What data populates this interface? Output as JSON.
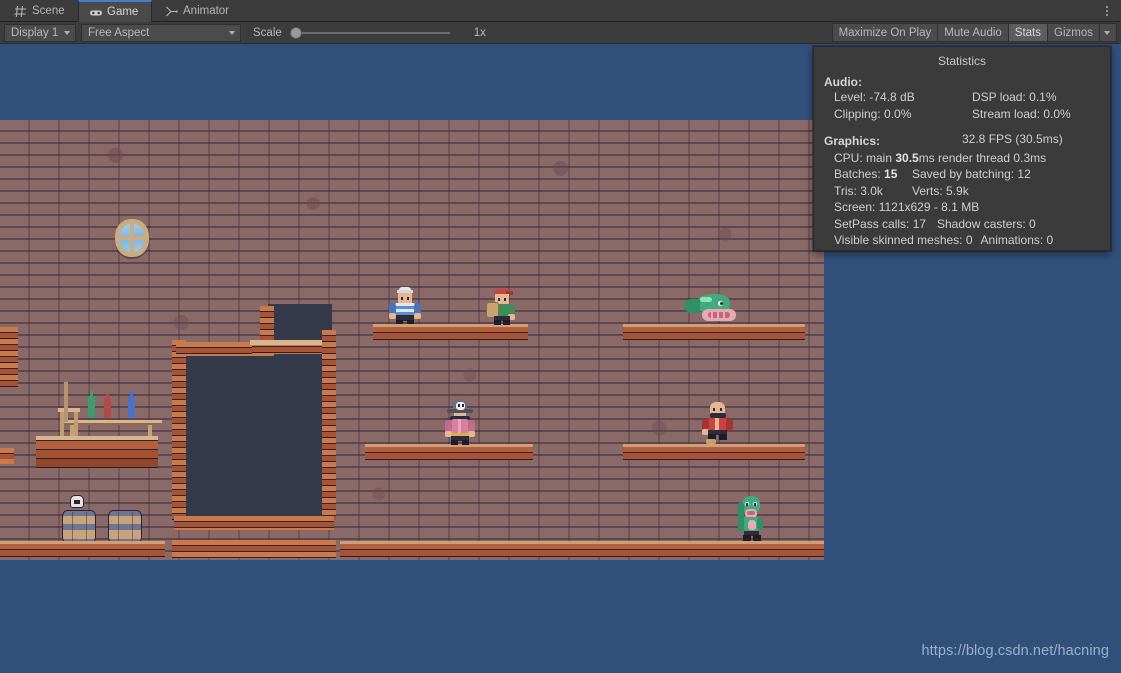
{
  "window": {
    "tabs": [
      {
        "label": "Scene",
        "icon": "grid-icon",
        "active": false
      },
      {
        "label": "Game",
        "icon": "gamepad-icon",
        "active": true
      },
      {
        "label": "Animator",
        "icon": "animator-icon",
        "active": false
      }
    ],
    "overflow_menu_icon": "kebab-menu-icon"
  },
  "toolbar": {
    "display_label": "Display 1",
    "aspect_label": "Free Aspect",
    "scale_label": "Scale",
    "scale_value": "1x",
    "maximize_on_play_label": "Maximize On Play",
    "mute_audio_label": "Mute Audio",
    "stats_label": "Stats",
    "stats_active": true,
    "gizmos_label": "Gizmos",
    "gizmos_caret_icon": "chevron-down-icon"
  },
  "statistics": {
    "title": "Statistics",
    "audio_heading": "Audio:",
    "audio_level": "Level: -74.8 dB",
    "audio_clipping": "Clipping: 0.0%",
    "dsp_load": "DSP load: 0.1%",
    "stream_load": "Stream load: 0.0%",
    "graphics_heading": "Graphics:",
    "fps": "32.8 FPS (30.5ms)",
    "cpu_prefix": "CPU: main ",
    "cpu_main_value": "30.5",
    "cpu_suffix": "ms  render thread 0.3ms",
    "batches_prefix": "Batches: ",
    "batches_value": "15",
    "saved_by_batching": "Saved by batching: 12",
    "tris": "Tris: 3.0k",
    "verts": "Verts: 5.9k",
    "screen": "Screen: 1121x629 - 8.1 MB",
    "setpass_calls": "SetPass calls: 17",
    "shadow_casters": "Shadow casters: 0",
    "visible_skinned_meshes": "Visible skinned meshes: 0",
    "animations": "Animations: 0"
  },
  "scene": {
    "background_color": "#32507c",
    "wall_color": "#8a6a68",
    "platform_color": "#b4603c",
    "doorway_color": "#343a4a",
    "props": [
      {
        "name": "porthole-window",
        "label": "Porthole Window"
      },
      {
        "name": "bar-counter",
        "label": "Bar Counter"
      },
      {
        "name": "bottle-green",
        "label": "Green Bottle"
      },
      {
        "name": "bottle-red",
        "label": "Red Bottle"
      },
      {
        "name": "bottle-blue",
        "label": "Blue Bottle"
      },
      {
        "name": "barrel-left",
        "label": "Barrel"
      },
      {
        "name": "barrel-right",
        "label": "Barrel"
      },
      {
        "name": "skull-prop",
        "label": "Skull"
      },
      {
        "name": "doorway",
        "label": "Doorway"
      }
    ],
    "characters": [
      {
        "name": "sailor-character",
        "label": "Sailor"
      },
      {
        "name": "pirate-bandana-character",
        "label": "Pirate with Bandana"
      },
      {
        "name": "fish-enemy",
        "label": "Flying Fish"
      },
      {
        "name": "captain-character",
        "label": "Skull-Hat Captain"
      },
      {
        "name": "bald-pirate-character",
        "label": "Bald Pirate"
      },
      {
        "name": "fishman-character",
        "label": "Fishman"
      }
    ]
  },
  "watermark": {
    "url": "https://blog.csdn.net/hacning"
  }
}
